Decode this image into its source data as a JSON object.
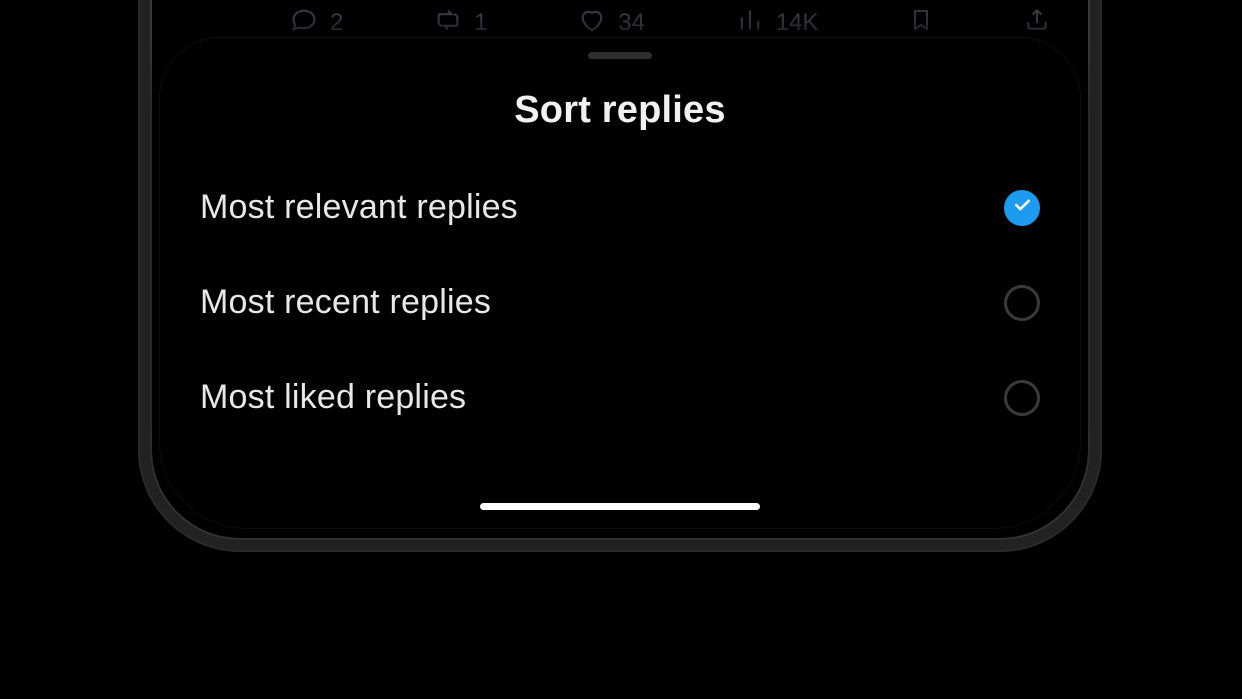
{
  "colors": {
    "accent": "#1d9bf0"
  },
  "action_bar": {
    "reply_count": "2",
    "repost_count": "1",
    "like_count": "34",
    "view_count": "14K"
  },
  "sheet": {
    "title": "Sort replies",
    "options": [
      {
        "label": "Most relevant replies",
        "selected": true
      },
      {
        "label": "Most recent replies",
        "selected": false
      },
      {
        "label": "Most liked replies",
        "selected": false
      }
    ]
  }
}
